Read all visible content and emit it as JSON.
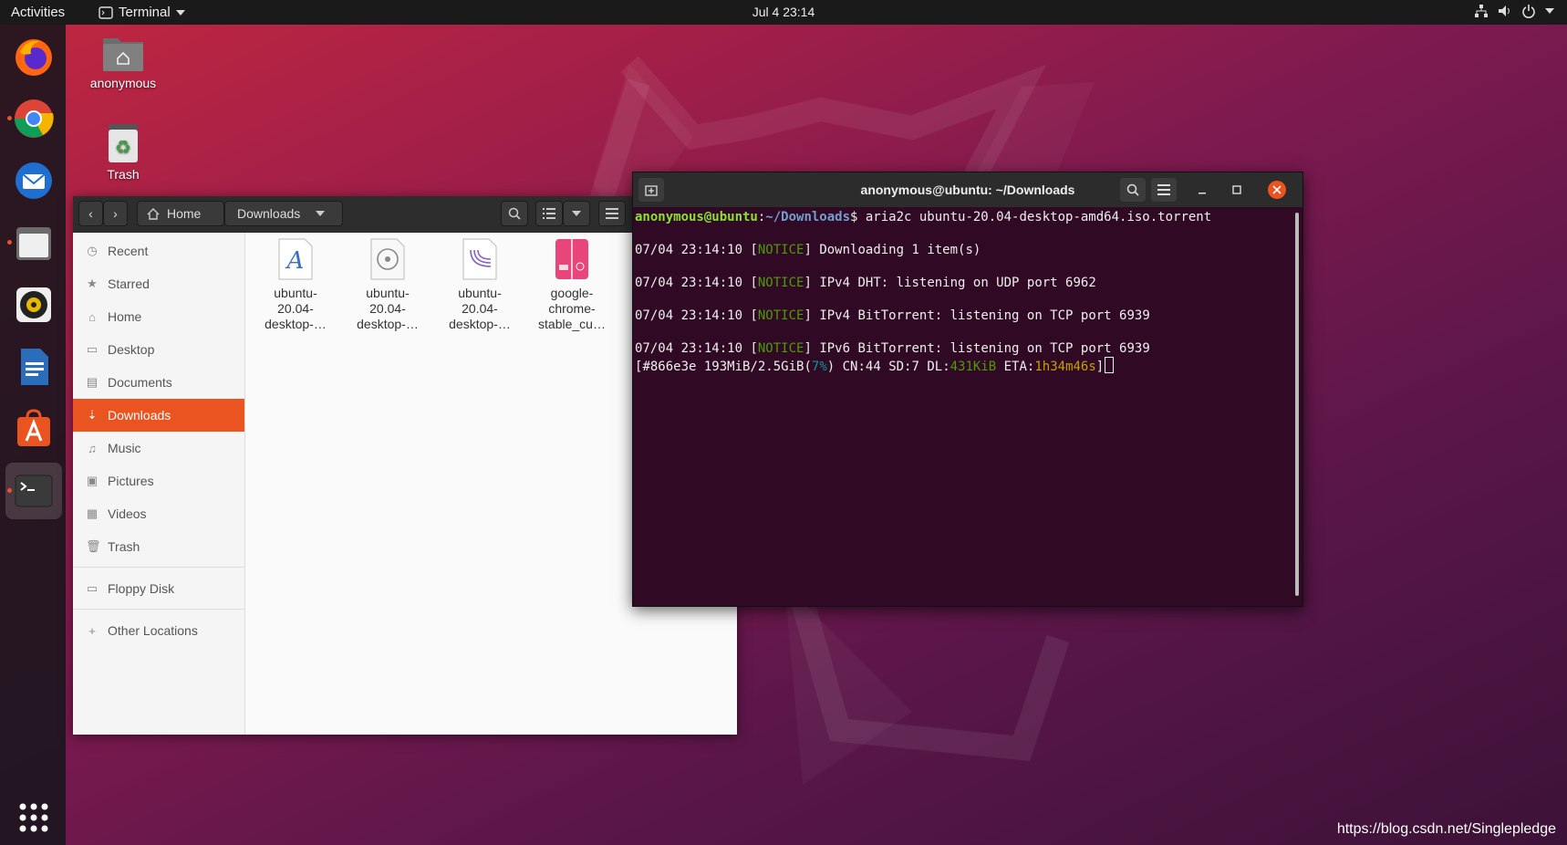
{
  "topbar": {
    "activities": "Activities",
    "app_menu": "Terminal",
    "clock": "Jul 4  23:14"
  },
  "desktop": {
    "home_icon_label": "anonymous",
    "trash_icon_label": "Trash"
  },
  "files": {
    "back_icon": "chevron-left-icon",
    "forward_icon": "chevron-right-icon",
    "path": [
      "Home",
      "Downloads"
    ],
    "sidebar": [
      {
        "label": "Recent",
        "icon": "clock-icon"
      },
      {
        "label": "Starred",
        "icon": "star-icon"
      },
      {
        "label": "Home",
        "icon": "home-icon"
      },
      {
        "label": "Desktop",
        "icon": "desktop-icon"
      },
      {
        "label": "Documents",
        "icon": "document-icon"
      },
      {
        "label": "Downloads",
        "icon": "download-icon",
        "selected": true
      },
      {
        "label": "Music",
        "icon": "music-icon"
      },
      {
        "label": "Pictures",
        "icon": "picture-icon"
      },
      {
        "label": "Videos",
        "icon": "video-icon"
      },
      {
        "label": "Trash",
        "icon": "trash-icon"
      }
    ],
    "devices": [
      {
        "label": "Floppy Disk",
        "icon": "floppy-icon"
      }
    ],
    "other": [
      {
        "label": "Other Locations",
        "icon": "plus-icon"
      }
    ],
    "items": [
      {
        "name_lines": [
          "ubuntu-",
          "20.04-",
          "desktop-…"
        ],
        "icon": "font-file-icon"
      },
      {
        "name_lines": [
          "ubuntu-",
          "20.04-",
          "desktop-…"
        ],
        "icon": "disc-image-icon"
      },
      {
        "name_lines": [
          "ubuntu-",
          "20.04-",
          "desktop-…"
        ],
        "icon": "torrent-file-icon"
      },
      {
        "name_lines": [
          "google-",
          "chrome-",
          "stable_cu…"
        ],
        "icon": "deb-package-icon"
      }
    ]
  },
  "terminal": {
    "title": "anonymous@ubuntu: ~/Downloads",
    "prompt_user": "anonymous@ubuntu",
    "prompt_sep": ":",
    "prompt_path": "~/Downloads",
    "prompt_end": "$ ",
    "command": "aria2c ubuntu-20.04-desktop-amd64.iso.torrent",
    "notices": [
      {
        "time": "07/04 23:14:10 ",
        "tag": "NOTICE",
        "msg": " Downloading 1 item(s)"
      },
      {
        "time": "07/04 23:14:10 ",
        "tag": "NOTICE",
        "msg": " IPv4 DHT: listening on UDP port 6962"
      },
      {
        "time": "07/04 23:14:10 ",
        "tag": "NOTICE",
        "msg": " IPv4 BitTorrent: listening on TCP port 6939"
      },
      {
        "time": "07/04 23:14:10 ",
        "tag": "NOTICE",
        "msg": " IPv6 BitTorrent: listening on TCP port 6939"
      }
    ],
    "progress": {
      "gid": "#866e3e 193MiB/2.5GiB",
      "percent": "7%",
      "peers": " CN:44 SD:7 DL:",
      "speed": "431KiB",
      "eta_label": " ETA:",
      "eta": "1h34m46s"
    }
  },
  "watermark": "https://blog.csdn.net/Singlepledge",
  "colors": {
    "accent": "#e95420",
    "terminal_bg": "#300a24"
  }
}
